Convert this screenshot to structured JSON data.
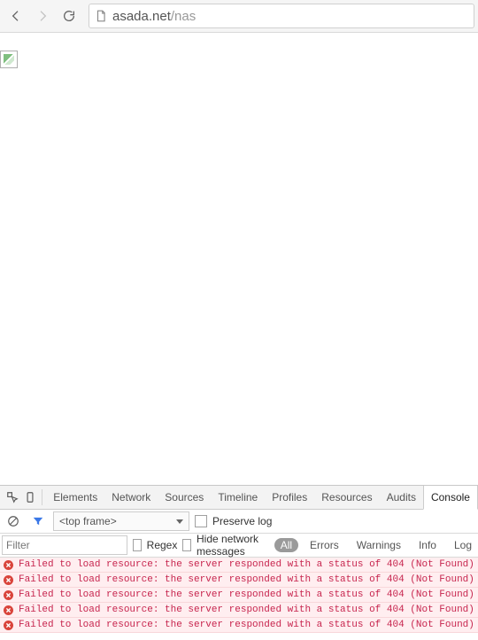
{
  "browser": {
    "url_host": "asada.net",
    "url_path": "/nas"
  },
  "devtools": {
    "tabs": [
      "Elements",
      "Network",
      "Sources",
      "Timeline",
      "Profiles",
      "Resources",
      "Audits",
      "Console"
    ],
    "active_tab": "Console",
    "frame_selector": "<top frame>",
    "preserve_log_label": "Preserve log",
    "filter_placeholder": "Filter",
    "regex_label": "Regex",
    "hide_network_label": "Hide network messages",
    "levels": [
      "All",
      "Errors",
      "Warnings",
      "Info",
      "Log"
    ],
    "active_level": "All",
    "errors": [
      "Failed to load resource: the server responded with a status of 404 (Not Found)",
      "Failed to load resource: the server responded with a status of 404 (Not Found)",
      "Failed to load resource: the server responded with a status of 404 (Not Found)",
      "Failed to load resource: the server responded with a status of 404 (Not Found)",
      "Failed to load resource: the server responded with a status of 404 (Not Found)"
    ]
  }
}
